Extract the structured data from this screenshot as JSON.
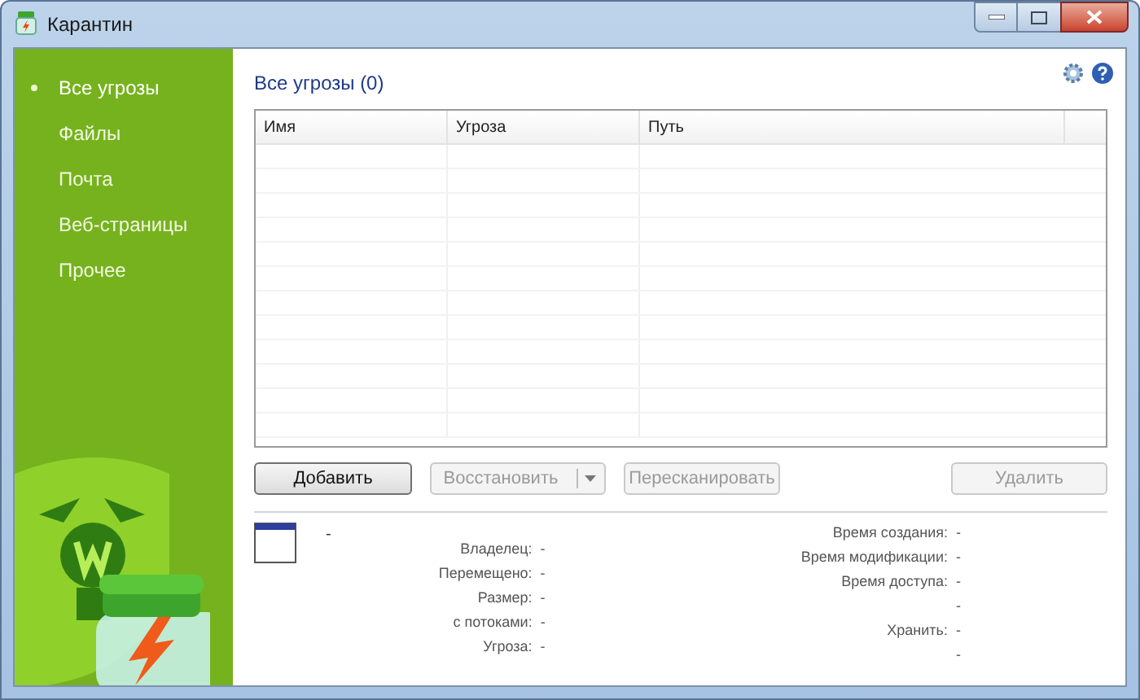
{
  "window": {
    "title": "Карантин"
  },
  "sidebar": {
    "items": [
      {
        "label": "Все угрозы",
        "selected": true
      },
      {
        "label": "Файлы",
        "selected": false
      },
      {
        "label": "Почта",
        "selected": false
      },
      {
        "label": "Веб-страницы",
        "selected": false
      },
      {
        "label": "Прочее",
        "selected": false
      }
    ]
  },
  "heading": "Все угрозы (0)",
  "table": {
    "columns": [
      "Имя",
      "Угроза",
      "Путь"
    ]
  },
  "buttons": [
    {
      "label": "Добавить",
      "disabled": false,
      "kind": "plain"
    },
    {
      "label": "Восстановить",
      "disabled": true,
      "kind": "split"
    },
    {
      "label": "Пересканировать",
      "disabled": true,
      "kind": "plain"
    },
    {
      "label": "Удалить",
      "disabled": true,
      "kind": "plain"
    }
  ],
  "details": {
    "name": "-",
    "left": [
      "Владелец:  -",
      "Перемещено:  -",
      "Размер:  -",
      "с потоками:  -",
      "Угроза:  -"
    ],
    "right": [
      "Время создания:  -",
      "Время модификации:  -",
      "Время доступа:  -",
      "-",
      "Хранить:  -",
      "-"
    ]
  }
}
